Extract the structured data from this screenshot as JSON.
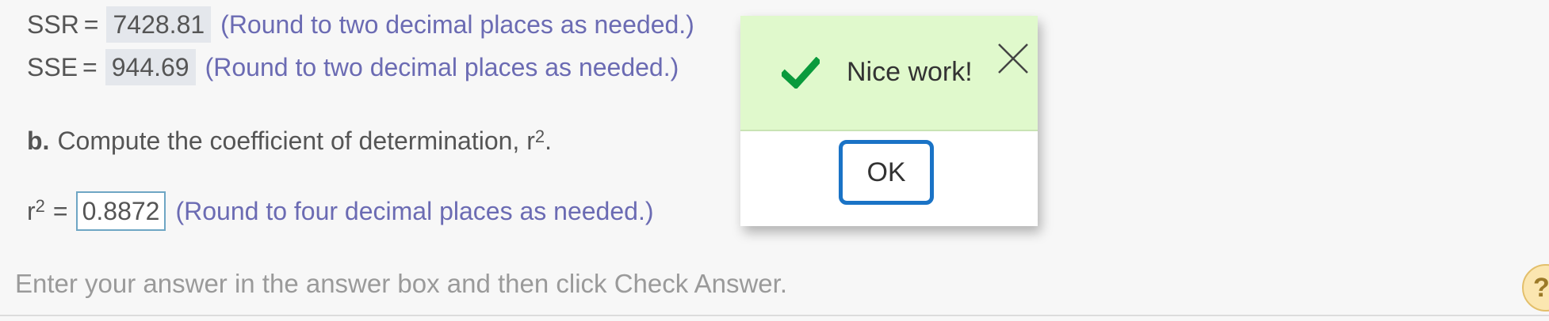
{
  "ssr": {
    "label": "SSR",
    "equals": "=",
    "value": "7428.81",
    "hint": "(Round to two decimal places as needed.)"
  },
  "sse": {
    "label": "SSE",
    "equals": "=",
    "value": "944.69",
    "hint": "(Round to two decimal places as needed.)"
  },
  "part_b": {
    "letter": "b.",
    "prompt": "Compute the coefficient of determination, r",
    "exponent": "2",
    "period": "."
  },
  "r2": {
    "base": "r",
    "exponent": "2",
    "equals": "=",
    "value": "0.8872",
    "hint": "(Round to four decimal places as needed.)"
  },
  "footer": {
    "instruction": "Enter your answer in the answer box and then click Check Answer.",
    "help_symbol": "?"
  },
  "dialog": {
    "message": "Nice work!",
    "ok_label": "OK",
    "success_color": "#0a9a3c",
    "header_color": "#e0f9cc",
    "button_border_color": "#1a73c6"
  }
}
